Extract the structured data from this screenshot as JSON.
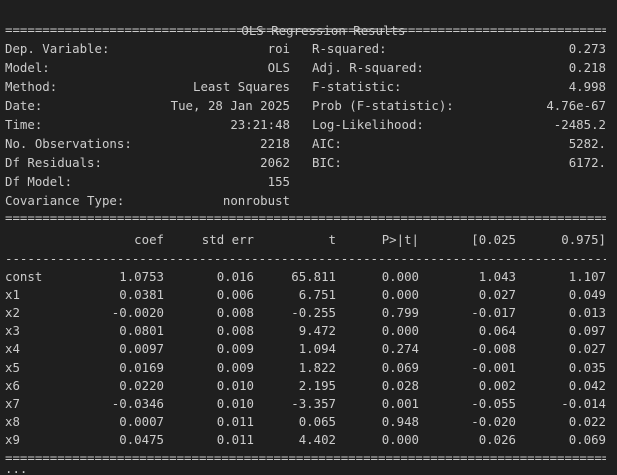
{
  "title": "OLS Regression Results",
  "double_rule": "=================================================================================================================",
  "single_rule": "-----------------------------------------------------------------------------------------------------------------",
  "summary_left": [
    {
      "label": "Dep. Variable:",
      "value": "roi"
    },
    {
      "label": "Model:",
      "value": "OLS"
    },
    {
      "label": "Method:",
      "value": "Least Squares"
    },
    {
      "label": "Date:",
      "value": "Tue, 28 Jan 2025"
    },
    {
      "label": "Time:",
      "value": "23:21:48"
    },
    {
      "label": "No. Observations:",
      "value": "2218"
    },
    {
      "label": "Df Residuals:",
      "value": "2062"
    },
    {
      "label": "Df Model:",
      "value": "155"
    },
    {
      "label": "Covariance Type:",
      "value": "nonrobust"
    }
  ],
  "summary_right": [
    {
      "label": "R-squared:",
      "value": "0.273"
    },
    {
      "label": "Adj. R-squared:",
      "value": "0.218"
    },
    {
      "label": "F-statistic:",
      "value": "4.998"
    },
    {
      "label": "Prob (F-statistic):",
      "value": "4.76e-67"
    },
    {
      "label": "Log-Likelihood:",
      "value": "-2485.2"
    },
    {
      "label": "AIC:",
      "value": "5282."
    },
    {
      "label": "BIC:",
      "value": "6172."
    }
  ],
  "coef_headers": [
    "coef",
    "std err",
    "t",
    "P>|t|",
    "[0.025",
    "0.975]"
  ],
  "coef_rows": [
    {
      "name": "const",
      "vals": [
        "1.0753",
        "0.016",
        "65.811",
        "0.000",
        "1.043",
        "1.107"
      ]
    },
    {
      "name": "x1",
      "vals": [
        "0.0381",
        "0.006",
        "6.751",
        "0.000",
        "0.027",
        "0.049"
      ]
    },
    {
      "name": "x2",
      "vals": [
        "-0.0020",
        "0.008",
        "-0.255",
        "0.799",
        "-0.017",
        "0.013"
      ]
    },
    {
      "name": "x3",
      "vals": [
        "0.0801",
        "0.008",
        "9.472",
        "0.000",
        "0.064",
        "0.097"
      ]
    },
    {
      "name": "x4",
      "vals": [
        "0.0097",
        "0.009",
        "1.094",
        "0.274",
        "-0.008",
        "0.027"
      ]
    },
    {
      "name": "x5",
      "vals": [
        "0.0169",
        "0.009",
        "1.822",
        "0.069",
        "-0.001",
        "0.035"
      ]
    },
    {
      "name": "x6",
      "vals": [
        "0.0220",
        "0.010",
        "2.195",
        "0.028",
        "0.002",
        "0.042"
      ]
    },
    {
      "name": "x7",
      "vals": [
        "-0.0346",
        "0.010",
        "-3.357",
        "0.001",
        "-0.055",
        "-0.014"
      ]
    },
    {
      "name": "x8",
      "vals": [
        "0.0007",
        "0.011",
        "0.065",
        "0.948",
        "-0.020",
        "0.022"
      ]
    },
    {
      "name": "x9",
      "vals": [
        "0.0475",
        "0.011",
        "4.402",
        "0.000",
        "0.026",
        "0.069"
      ]
    }
  ],
  "ellipsis": "..."
}
